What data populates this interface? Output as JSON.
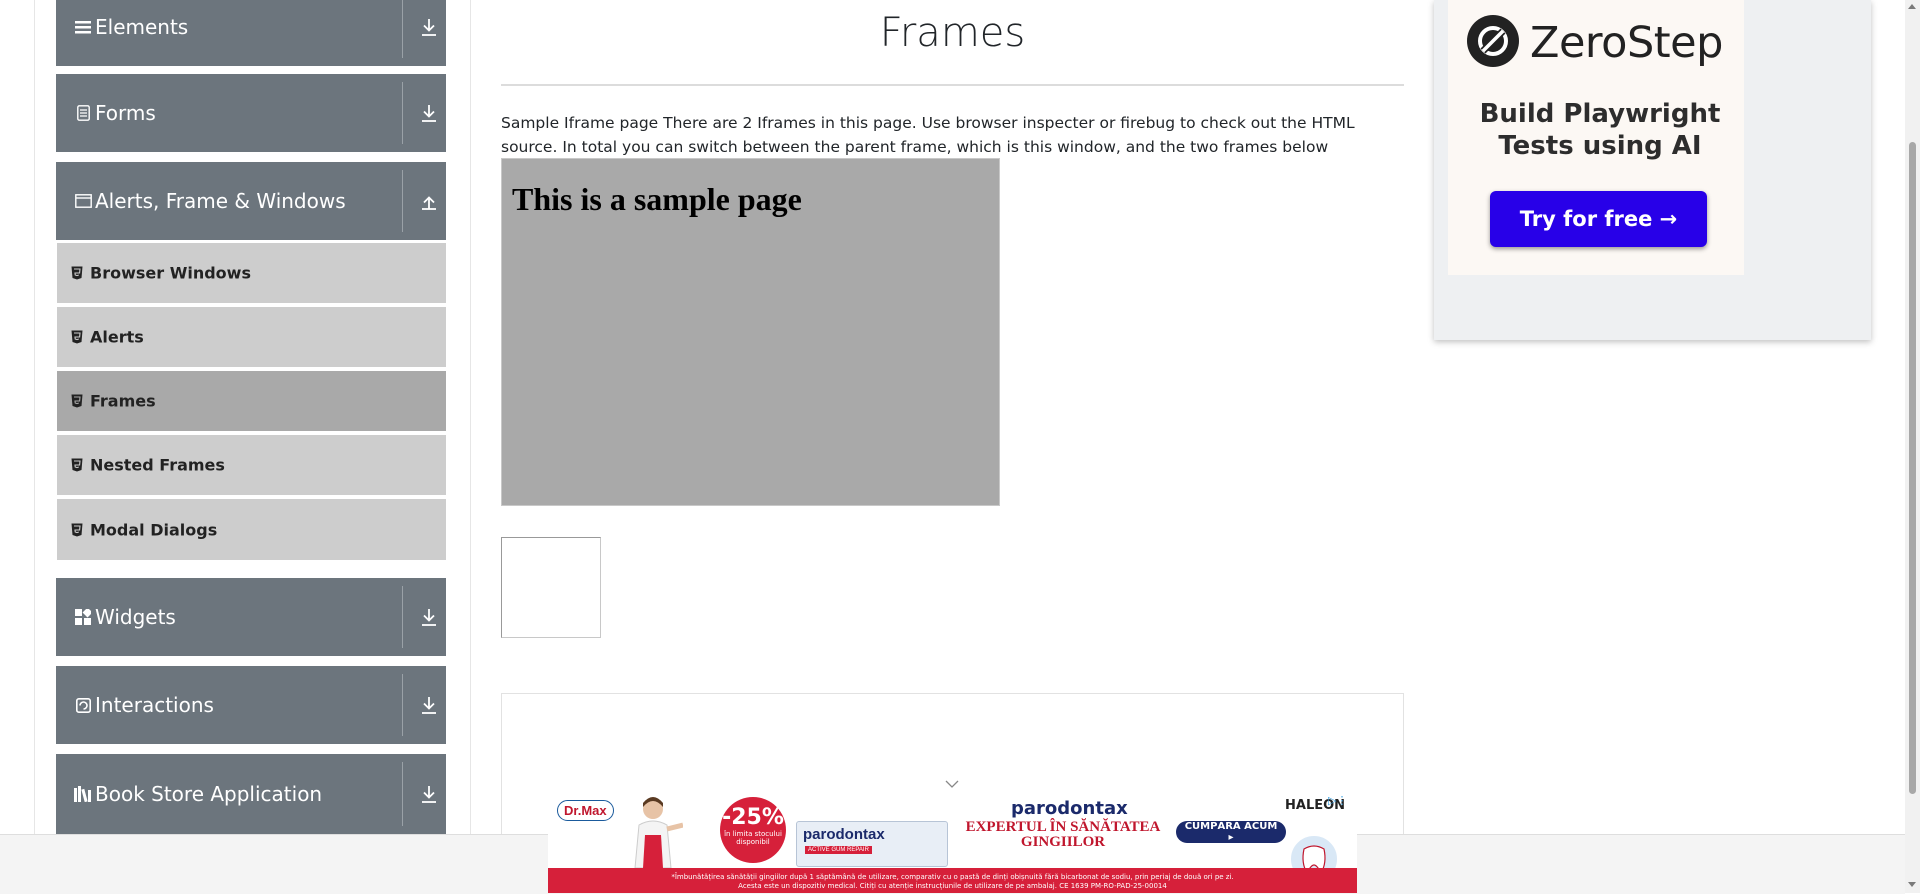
{
  "sidebar": {
    "groups": [
      {
        "label": "Elements",
        "icon": "list-icon",
        "state": "collapsed"
      },
      {
        "label": "Forms",
        "icon": "form-icon",
        "state": "collapsed"
      },
      {
        "label": "Alerts, Frame & Windows",
        "icon": "window-icon",
        "state": "expanded"
      },
      {
        "label": "Widgets",
        "icon": "widgets-icon",
        "state": "collapsed"
      },
      {
        "label": "Interactions",
        "icon": "interactions-icon",
        "state": "collapsed"
      },
      {
        "label": "Book Store Application",
        "icon": "books-icon",
        "state": "collapsed"
      }
    ],
    "sub_items": [
      {
        "label": "Browser Windows",
        "active": false
      },
      {
        "label": "Alerts",
        "active": false
      },
      {
        "label": "Frames",
        "active": true
      },
      {
        "label": "Nested Frames",
        "active": false
      },
      {
        "label": "Modal Dialogs",
        "active": false
      }
    ]
  },
  "main": {
    "title": "Frames",
    "intro": "Sample Iframe page There are 2 Iframes in this page. Use browser inspecter or firebug to check out the HTML source. In total you can switch between the parent frame, which is this window, and the two frames below",
    "frame1_heading": "This is a sample page"
  },
  "side_ad": {
    "brand": "ZeroStep",
    "tagline": "Build Playwright Tests using AI",
    "cta": "Try for free →"
  },
  "banner_ad": {
    "pharmacy": "Dr.Max",
    "discount": "-25%",
    "discount_condition": "în limita stocului disponibil",
    "product_name": "parodontax",
    "product_sub": "ACTIVE GUM REPAIR",
    "brand": "parodontax",
    "headline": "EXPERTUL ÎN SĂNĂTATEA GINGIILOR",
    "cta": "CUMPĂRĂ ACUM ▸",
    "company": "HALEON",
    "disclaimer_line1": "*Îmbunătățirea sănătății gingiilor după 1 săptămână de utilizare, comparativ cu o pastă de dinți obișnuită fără bicarbonat de sodiu, prin periaj de două ori pe zi.",
    "disclaimer_line2": "Acesta este un dispozitiv medical. Citiți cu atenție instrucțiunile de utilizare de pe ambalaj. CE 1639 PM-RO-PAD-25-00014"
  },
  "colors": {
    "group_bg": "#6c757d",
    "sub_bg": "#cdcdcd",
    "sub_active_bg": "#a9a9a9",
    "frame1_bg": "#a9a9a9",
    "zerostep_button": "#2800e8",
    "banner_red": "#d6203a"
  }
}
